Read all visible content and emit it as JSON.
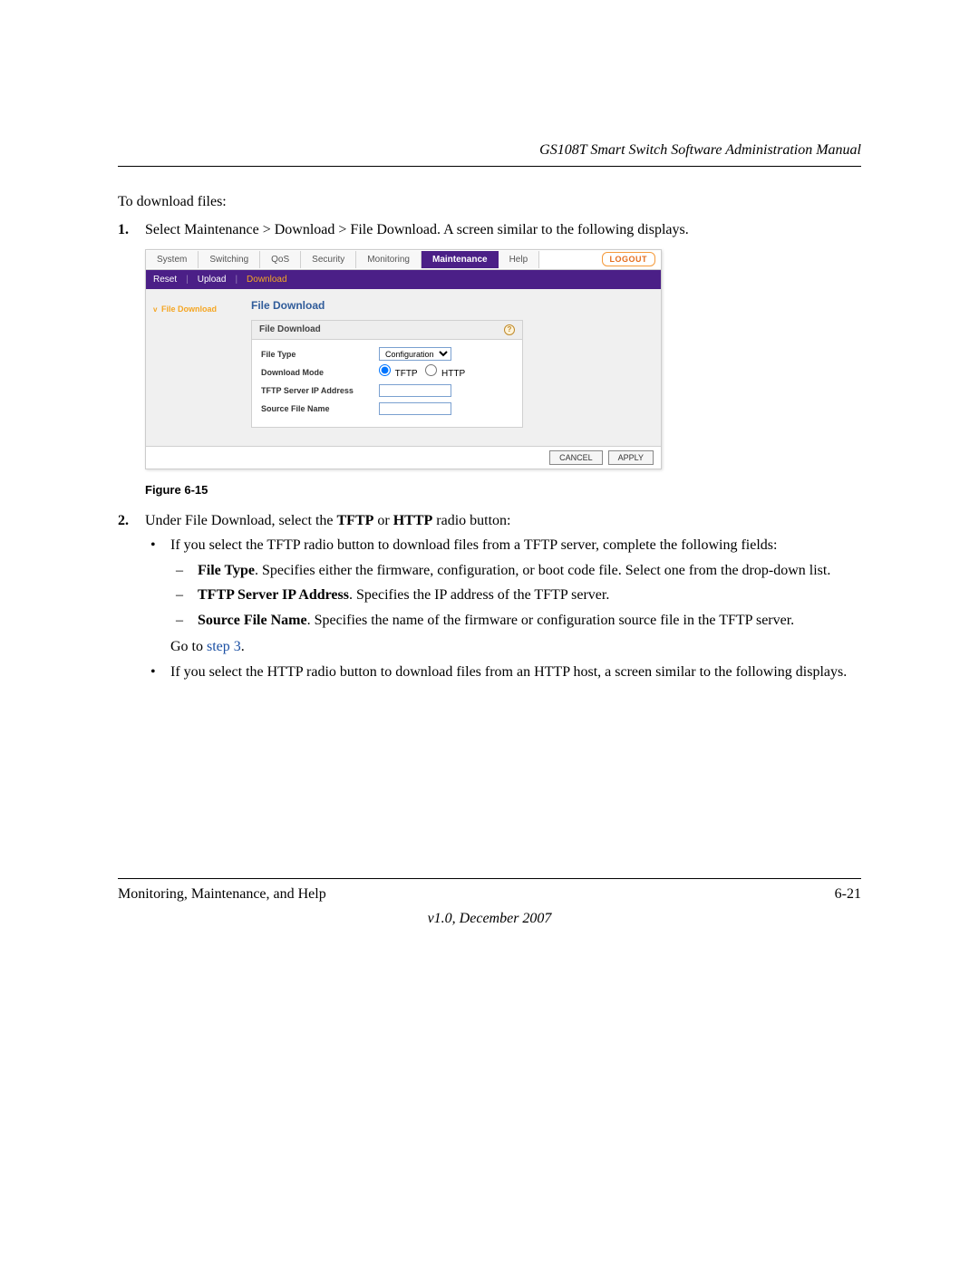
{
  "header": {
    "title": "GS108T Smart Switch Software Administration Manual"
  },
  "body": {
    "intro": "To download files:",
    "step1_num": "1.",
    "step1": "Select Maintenance > Download > File Download. A screen similar to the following displays.",
    "step2_num": "2.",
    "step2_pre": "Under File Download, select the ",
    "step2_b1": "TFTP",
    "step2_mid1": " or ",
    "step2_b2": "HTTP",
    "step2_post": " radio button:",
    "bullet_tftp": "If you select the TFTP radio button to download files from a TFTP server, complete the following fields:",
    "dash_filetype_b": "File Type",
    "dash_filetype_t": ". Specifies either the firmware, configuration, or boot code file. Select one from the drop-down list.",
    "dash_tftp_b": "TFTP Server IP Address",
    "dash_tftp_t": ". Specifies the IP address of the TFTP server.",
    "dash_src_b": "Source File Name",
    "dash_src_t": ". Specifies the name of the firmware or configuration source file in the TFTP server.",
    "goto_pre": "Go to ",
    "goto_link": "step 3",
    "goto_post": ".",
    "bullet_http": "If you select the HTTP radio button to download files from an HTTP host, a screen similar to the following displays."
  },
  "figure": {
    "caption": "Figure 6-15",
    "tabs": [
      "System",
      "Switching",
      "QoS",
      "Security",
      "Monitoring",
      "Maintenance",
      "Help"
    ],
    "logout": "LOGOUT",
    "subnav": {
      "reset": "Reset",
      "upload": "Upload",
      "download": "Download"
    },
    "sidenav": "File Download",
    "panel_title": "File Download",
    "box_title": "File Download",
    "rows": {
      "file_type_label": "File Type",
      "file_type_value": "Configuration",
      "mode_label": "Download Mode",
      "mode_tftp": "TFTP",
      "mode_http": "HTTP",
      "ip_label": "TFTP Server IP Address",
      "src_label": "Source File Name"
    },
    "buttons": {
      "cancel": "CANCEL",
      "apply": "APPLY"
    },
    "help_glyph": "?"
  },
  "footer": {
    "section": "Monitoring, Maintenance, and Help",
    "page": "6-21",
    "version": "v1.0, December 2007"
  }
}
